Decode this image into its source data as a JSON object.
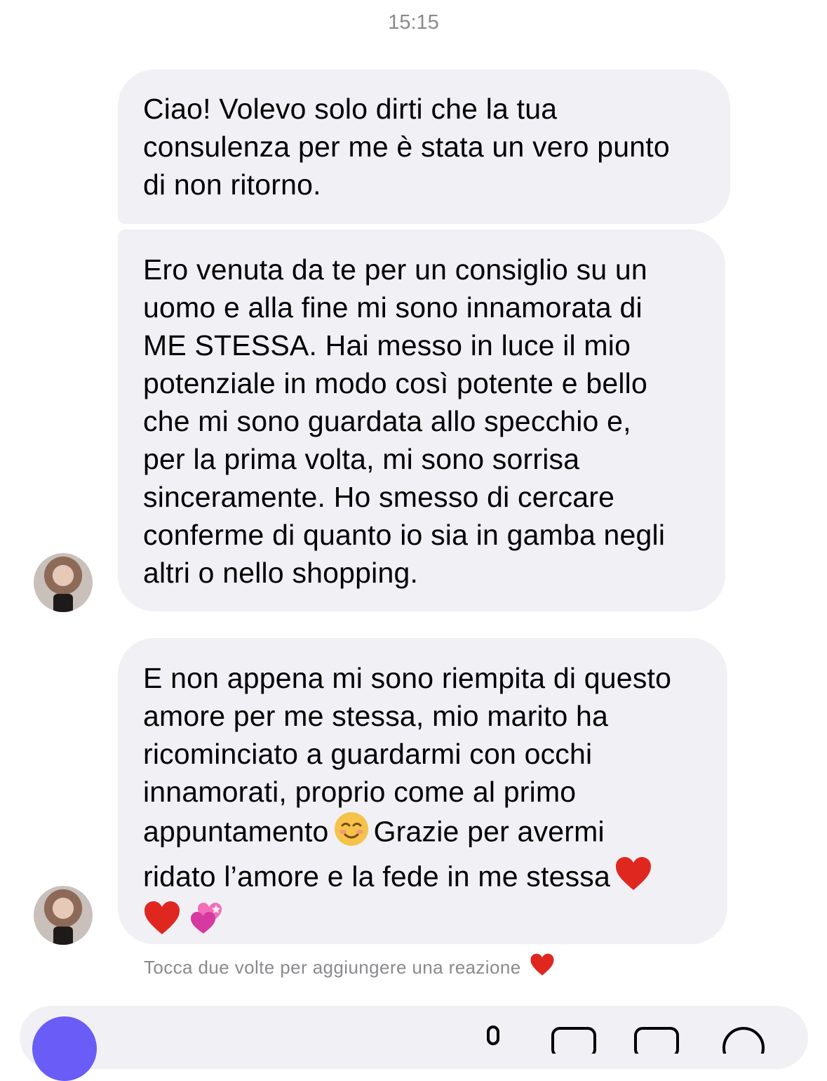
{
  "conversation": {
    "timestamp": "15:15",
    "messages": [
      {
        "text": "Ciao! Volevo solo dirti che la tua\nconsulenza per me è stata un vero punto\ndi non ritorno."
      },
      {
        "text": "Ero venuta da te per un consiglio su un\nuomo e alla fine mi sono innamorata di\nME STESSA. Hai messo in luce il mio\npotenziale in modo così potente e bello\nche mi sono guardata allo specchio e,\nper la prima volta, mi sono sorrisa\nsinceramente. Ho smesso di cercare\nconferme di quanto io sia in gamba negli\naltri o nello shopping."
      },
      {
        "text_part_1": "E non appena mi sono riempita di questo\namore per me stessa, mio marito ha\nricominciato a guardarmi con occhi\ninnamorati, proprio come al primo\nappuntamento",
        "text_part_2": "Grazie per avermi\nridato l’amore e la fede in me stessa",
        "emojis": [
          "smiling-face-icon",
          "red-heart-icon",
          "red-heart-icon",
          "two-hearts-icon"
        ]
      }
    ],
    "reaction_hint": "Tocca due volte per aggiungere una reazione",
    "reaction_hint_icon": "red-heart-icon"
  },
  "colors": {
    "bubble_background": "#f0f0f5",
    "meta_text": "#8a8a8e",
    "accent": "#6a5cf6",
    "heart": "#e0271f"
  }
}
